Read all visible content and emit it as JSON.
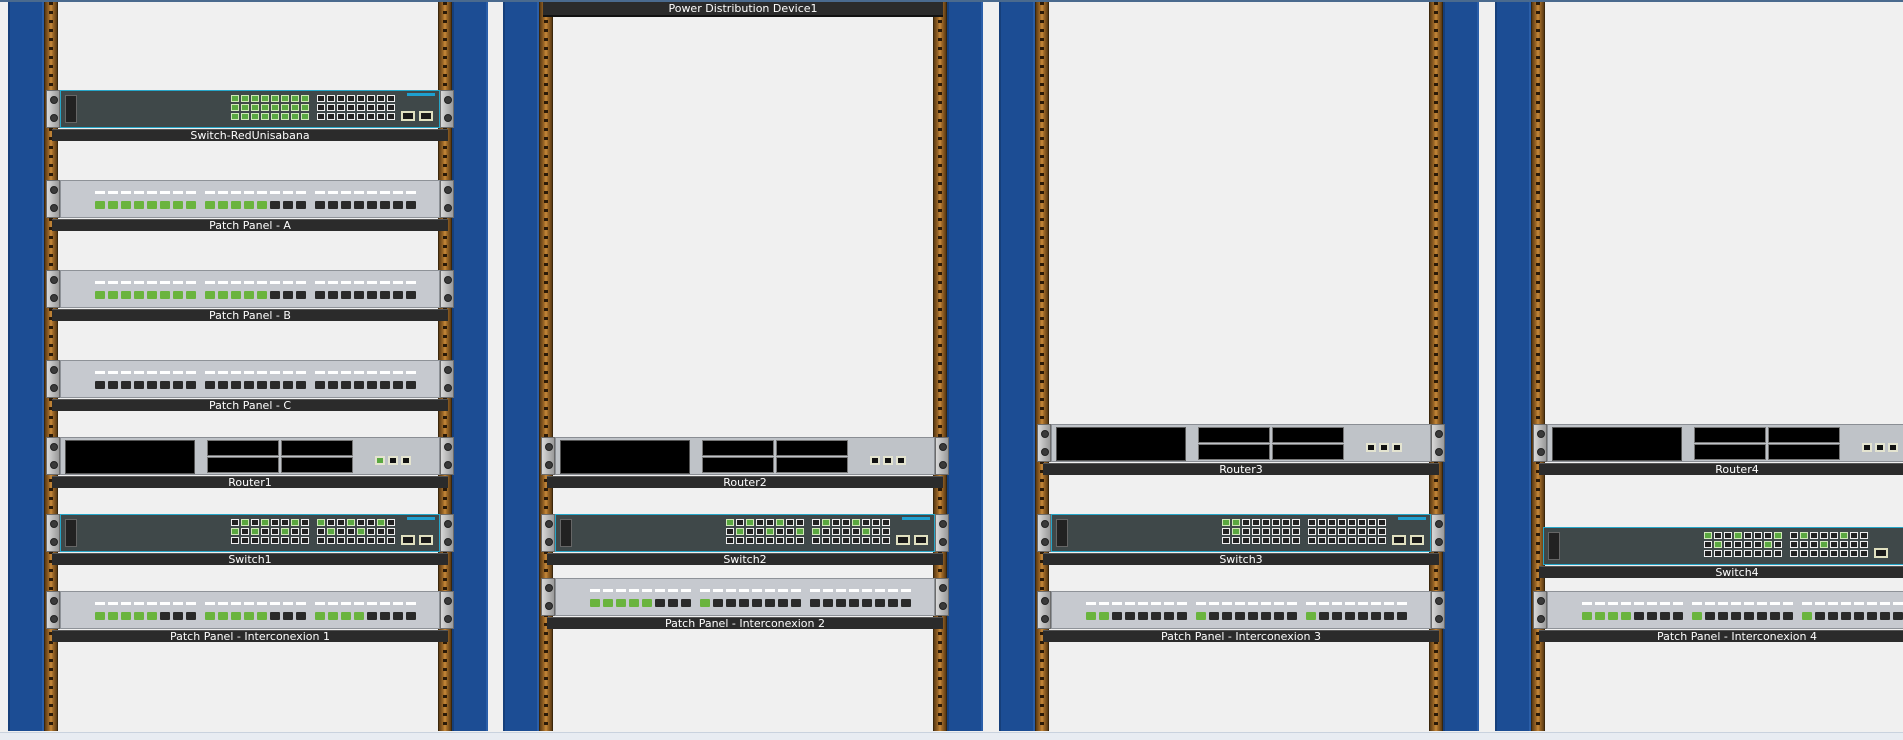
{
  "racks": [
    {
      "devices": {
        "switch": "Switch-RedUnisabana",
        "pp_a": "Patch Panel - A",
        "pp_b": "Patch Panel - B",
        "pp_c": "Patch Panel - C",
        "router": "Router1",
        "switch2": "Switch1",
        "pp_ic": "Patch Panel - Interconexion 1"
      }
    },
    {
      "devices": {
        "pdu": "Power Distribution Device1",
        "router": "Router2",
        "switch": "Switch2",
        "pp_ic": "Patch Panel - Interconexion 2"
      }
    },
    {
      "devices": {
        "router": "Router3",
        "switch": "Switch3",
        "pp_ic": "Patch Panel - Interconexion 3"
      }
    },
    {
      "devices": {
        "router": "Router4",
        "switch": "Switch4",
        "pp_ic": "Patch Panel - Interconexion 4"
      }
    }
  ],
  "colors": {
    "rack_post": "#1c4d94",
    "rail": "#a06a28",
    "port_active": "#5aa840",
    "switch_body": "#3f4849",
    "label_bar": "#2b2b2b"
  }
}
